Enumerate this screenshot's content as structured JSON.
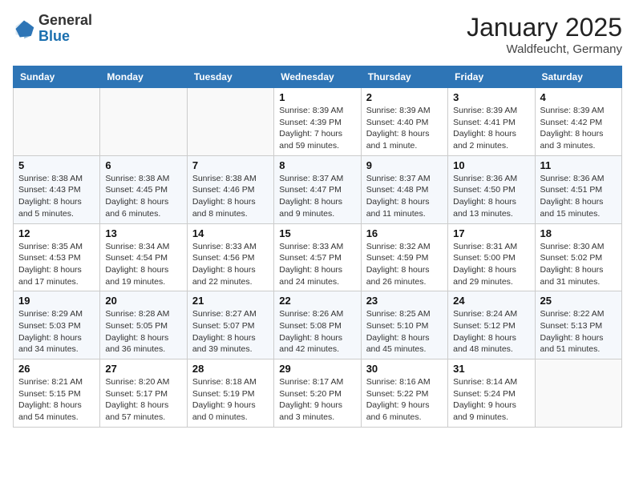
{
  "logo": {
    "general": "General",
    "blue": "Blue"
  },
  "header": {
    "month": "January 2025",
    "location": "Waldfeucht, Germany"
  },
  "weekdays": [
    "Sunday",
    "Monday",
    "Tuesday",
    "Wednesday",
    "Thursday",
    "Friday",
    "Saturday"
  ],
  "weeks": [
    [
      {
        "day": "",
        "info": ""
      },
      {
        "day": "",
        "info": ""
      },
      {
        "day": "",
        "info": ""
      },
      {
        "day": "1",
        "info": "Sunrise: 8:39 AM\nSunset: 4:39 PM\nDaylight: 7 hours\nand 59 minutes."
      },
      {
        "day": "2",
        "info": "Sunrise: 8:39 AM\nSunset: 4:40 PM\nDaylight: 8 hours\nand 1 minute."
      },
      {
        "day": "3",
        "info": "Sunrise: 8:39 AM\nSunset: 4:41 PM\nDaylight: 8 hours\nand 2 minutes."
      },
      {
        "day": "4",
        "info": "Sunrise: 8:39 AM\nSunset: 4:42 PM\nDaylight: 8 hours\nand 3 minutes."
      }
    ],
    [
      {
        "day": "5",
        "info": "Sunrise: 8:38 AM\nSunset: 4:43 PM\nDaylight: 8 hours\nand 5 minutes."
      },
      {
        "day": "6",
        "info": "Sunrise: 8:38 AM\nSunset: 4:45 PM\nDaylight: 8 hours\nand 6 minutes."
      },
      {
        "day": "7",
        "info": "Sunrise: 8:38 AM\nSunset: 4:46 PM\nDaylight: 8 hours\nand 8 minutes."
      },
      {
        "day": "8",
        "info": "Sunrise: 8:37 AM\nSunset: 4:47 PM\nDaylight: 8 hours\nand 9 minutes."
      },
      {
        "day": "9",
        "info": "Sunrise: 8:37 AM\nSunset: 4:48 PM\nDaylight: 8 hours\nand 11 minutes."
      },
      {
        "day": "10",
        "info": "Sunrise: 8:36 AM\nSunset: 4:50 PM\nDaylight: 8 hours\nand 13 minutes."
      },
      {
        "day": "11",
        "info": "Sunrise: 8:36 AM\nSunset: 4:51 PM\nDaylight: 8 hours\nand 15 minutes."
      }
    ],
    [
      {
        "day": "12",
        "info": "Sunrise: 8:35 AM\nSunset: 4:53 PM\nDaylight: 8 hours\nand 17 minutes."
      },
      {
        "day": "13",
        "info": "Sunrise: 8:34 AM\nSunset: 4:54 PM\nDaylight: 8 hours\nand 19 minutes."
      },
      {
        "day": "14",
        "info": "Sunrise: 8:33 AM\nSunset: 4:56 PM\nDaylight: 8 hours\nand 22 minutes."
      },
      {
        "day": "15",
        "info": "Sunrise: 8:33 AM\nSunset: 4:57 PM\nDaylight: 8 hours\nand 24 minutes."
      },
      {
        "day": "16",
        "info": "Sunrise: 8:32 AM\nSunset: 4:59 PM\nDaylight: 8 hours\nand 26 minutes."
      },
      {
        "day": "17",
        "info": "Sunrise: 8:31 AM\nSunset: 5:00 PM\nDaylight: 8 hours\nand 29 minutes."
      },
      {
        "day": "18",
        "info": "Sunrise: 8:30 AM\nSunset: 5:02 PM\nDaylight: 8 hours\nand 31 minutes."
      }
    ],
    [
      {
        "day": "19",
        "info": "Sunrise: 8:29 AM\nSunset: 5:03 PM\nDaylight: 8 hours\nand 34 minutes."
      },
      {
        "day": "20",
        "info": "Sunrise: 8:28 AM\nSunset: 5:05 PM\nDaylight: 8 hours\nand 36 minutes."
      },
      {
        "day": "21",
        "info": "Sunrise: 8:27 AM\nSunset: 5:07 PM\nDaylight: 8 hours\nand 39 minutes."
      },
      {
        "day": "22",
        "info": "Sunrise: 8:26 AM\nSunset: 5:08 PM\nDaylight: 8 hours\nand 42 minutes."
      },
      {
        "day": "23",
        "info": "Sunrise: 8:25 AM\nSunset: 5:10 PM\nDaylight: 8 hours\nand 45 minutes."
      },
      {
        "day": "24",
        "info": "Sunrise: 8:24 AM\nSunset: 5:12 PM\nDaylight: 8 hours\nand 48 minutes."
      },
      {
        "day": "25",
        "info": "Sunrise: 8:22 AM\nSunset: 5:13 PM\nDaylight: 8 hours\nand 51 minutes."
      }
    ],
    [
      {
        "day": "26",
        "info": "Sunrise: 8:21 AM\nSunset: 5:15 PM\nDaylight: 8 hours\nand 54 minutes."
      },
      {
        "day": "27",
        "info": "Sunrise: 8:20 AM\nSunset: 5:17 PM\nDaylight: 8 hours\nand 57 minutes."
      },
      {
        "day": "28",
        "info": "Sunrise: 8:18 AM\nSunset: 5:19 PM\nDaylight: 9 hours\nand 0 minutes."
      },
      {
        "day": "29",
        "info": "Sunrise: 8:17 AM\nSunset: 5:20 PM\nDaylight: 9 hours\nand 3 minutes."
      },
      {
        "day": "30",
        "info": "Sunrise: 8:16 AM\nSunset: 5:22 PM\nDaylight: 9 hours\nand 6 minutes."
      },
      {
        "day": "31",
        "info": "Sunrise: 8:14 AM\nSunset: 5:24 PM\nDaylight: 9 hours\nand 9 minutes."
      },
      {
        "day": "",
        "info": ""
      }
    ]
  ]
}
